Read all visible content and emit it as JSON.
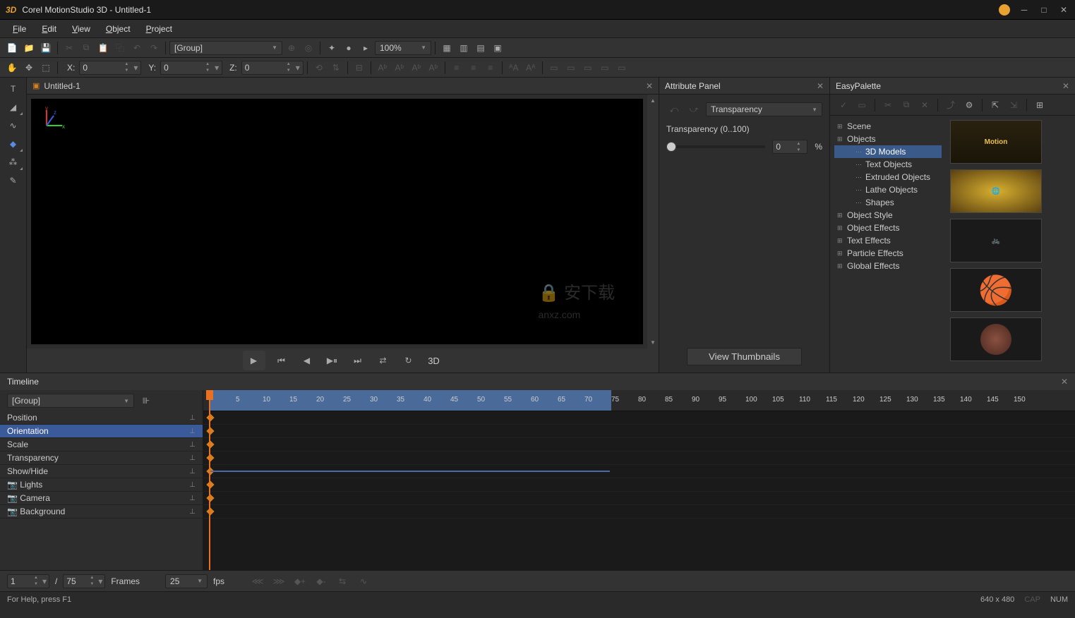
{
  "title": "Corel MotionStudio 3D - Untitled-1",
  "logo": "3D",
  "menus": [
    "File",
    "Edit",
    "View",
    "Object",
    "Project"
  ],
  "toolbar1": {
    "group_dropdown": "[Group]",
    "zoom": "100%"
  },
  "coords": {
    "x_label": "X:",
    "x": "0",
    "y_label": "Y:",
    "y": "0",
    "z_label": "Z:",
    "z": "0"
  },
  "viewport": {
    "tab_title": "Untitled-1",
    "watermark": "安下载\nanxz.com",
    "mode3d": "3D"
  },
  "attribute_panel": {
    "title": "Attribute Panel",
    "dropdown": "Transparency",
    "label": "Transparency (0..100)",
    "value": "0",
    "percent": "%",
    "view_thumbs": "View Thumbnails"
  },
  "easy_palette": {
    "title": "EasyPalette",
    "tree": [
      {
        "label": "Scene",
        "level": 0,
        "exp": "+"
      },
      {
        "label": "Objects",
        "level": 0,
        "exp": "−"
      },
      {
        "label": "3D Models",
        "level": 2,
        "sel": true
      },
      {
        "label": "Text Objects",
        "level": 2
      },
      {
        "label": "Extruded Objects",
        "level": 2
      },
      {
        "label": "Lathe Objects",
        "level": 2
      },
      {
        "label": "Shapes",
        "level": 2
      },
      {
        "label": "Object Style",
        "level": 0,
        "exp": "+"
      },
      {
        "label": "Object Effects",
        "level": 0,
        "exp": "+"
      },
      {
        "label": "Text Effects",
        "level": 0,
        "exp": "+"
      },
      {
        "label": "Particle Effects",
        "level": 0,
        "exp": "+"
      },
      {
        "label": "Global Effects",
        "level": 0,
        "exp": "+"
      }
    ]
  },
  "timeline": {
    "title": "Timeline",
    "group_dropdown": "[Group]",
    "tracks": [
      {
        "label": "Position"
      },
      {
        "label": "Orientation",
        "sel": true
      },
      {
        "label": "Scale"
      },
      {
        "label": "Transparency"
      },
      {
        "label": "Show/Hide"
      },
      {
        "label": "Lights",
        "icon": true
      },
      {
        "label": "Camera",
        "icon": true
      },
      {
        "label": "Background",
        "icon": true
      }
    ],
    "ruler_ticks": [
      "5",
      "10",
      "15",
      "20",
      "25",
      "30",
      "35",
      "40",
      "45",
      "50",
      "55",
      "60",
      "65",
      "70",
      "75",
      "80",
      "85",
      "90",
      "95",
      "100",
      "105",
      "110",
      "115",
      "120",
      "125",
      "130",
      "135",
      "140",
      "145",
      "150"
    ],
    "frame_current": "1",
    "frame_sep": "/",
    "frame_total": "75",
    "frames_label": "Frames",
    "fps_value": "25",
    "fps_label": "fps"
  },
  "statusbar": {
    "help": "For Help, press F1",
    "dims": "640 x 480",
    "cap": "CAP",
    "num": "NUM"
  }
}
